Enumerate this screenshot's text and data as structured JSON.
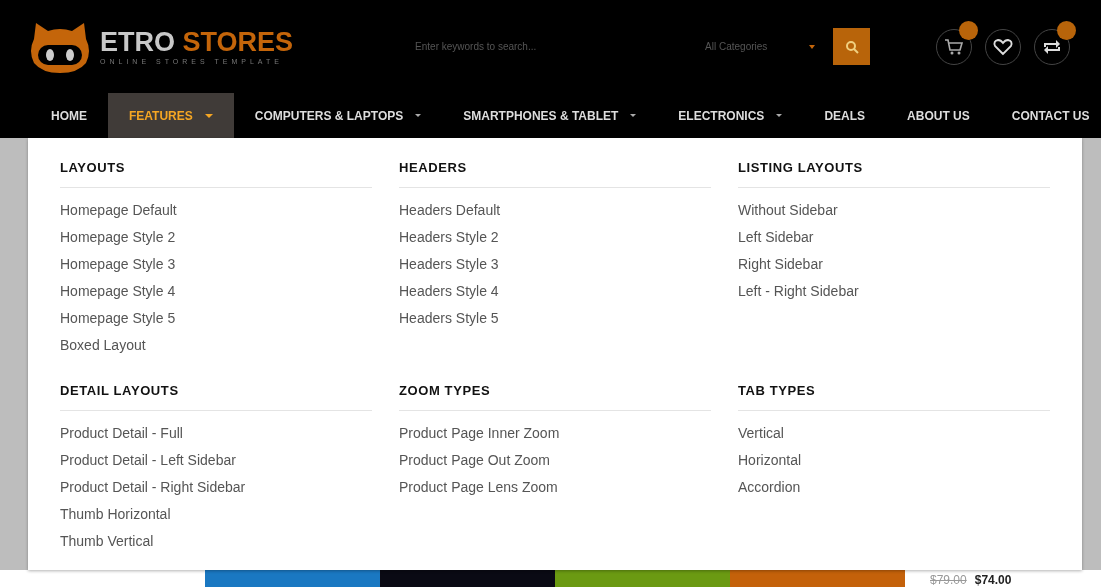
{
  "logo": {
    "brand_first": "ETRO",
    "brand_second": "STORES",
    "tagline": "ONLINE STORES TEMPLATE"
  },
  "search": {
    "placeholder": "Enter keywords to search...",
    "category": "All Categories"
  },
  "nav": [
    {
      "label": "HOME",
      "selected": false,
      "dropdown": false
    },
    {
      "label": "FEATURES",
      "selected": true,
      "dropdown": true
    },
    {
      "label": "COMPUTERS & LAPTOPS",
      "selected": false,
      "dropdown": true
    },
    {
      "label": "SMARTPHONES & TABLET",
      "selected": false,
      "dropdown": true
    },
    {
      "label": "ELECTRONICS",
      "selected": false,
      "dropdown": true
    },
    {
      "label": "DEALS",
      "selected": false,
      "dropdown": false
    },
    {
      "label": "ABOUT US",
      "selected": false,
      "dropdown": false
    },
    {
      "label": "CONTACT US",
      "selected": false,
      "dropdown": false
    }
  ],
  "mega_menu": [
    {
      "title": "LAYOUTS",
      "items": [
        "Homepage Default",
        "Homepage Style 2",
        "Homepage Style 3",
        "Homepage Style 4",
        "Homepage Style 5",
        "Boxed Layout"
      ]
    },
    {
      "title": "HEADERS",
      "items": [
        "Headers Default",
        "Headers Style 2",
        "Headers Style 3",
        "Headers Style 4",
        "Headers Style 5"
      ]
    },
    {
      "title": "LISTING LAYOUTS",
      "items": [
        "Without Sidebar",
        "Left Sidebar",
        "Right Sidebar",
        "Left - Right Sidebar"
      ]
    },
    {
      "title": "DETAIL LAYOUTS",
      "items": [
        "Product Detail - Full",
        "Product Detail - Left Sidebar",
        "Product Detail - Right Sidebar",
        "Thumb Horizontal",
        "Thumb Vertical"
      ]
    },
    {
      "title": "ZOOM TYPES",
      "items": [
        "Product Page Inner Zoom",
        "Product Page Out Zoom",
        "Product Page Lens Zoom"
      ]
    },
    {
      "title": "TAB TYPES",
      "items": [
        "Vertical",
        "Horizontal",
        "Accordion"
      ]
    }
  ],
  "banners": [
    {
      "color": "#1a78c2"
    },
    {
      "color": "#0a0a14"
    },
    {
      "color": "#6b9a12"
    },
    {
      "color": "#c4610a"
    }
  ],
  "price": {
    "old": "$79.00",
    "new": "$74.00"
  }
}
